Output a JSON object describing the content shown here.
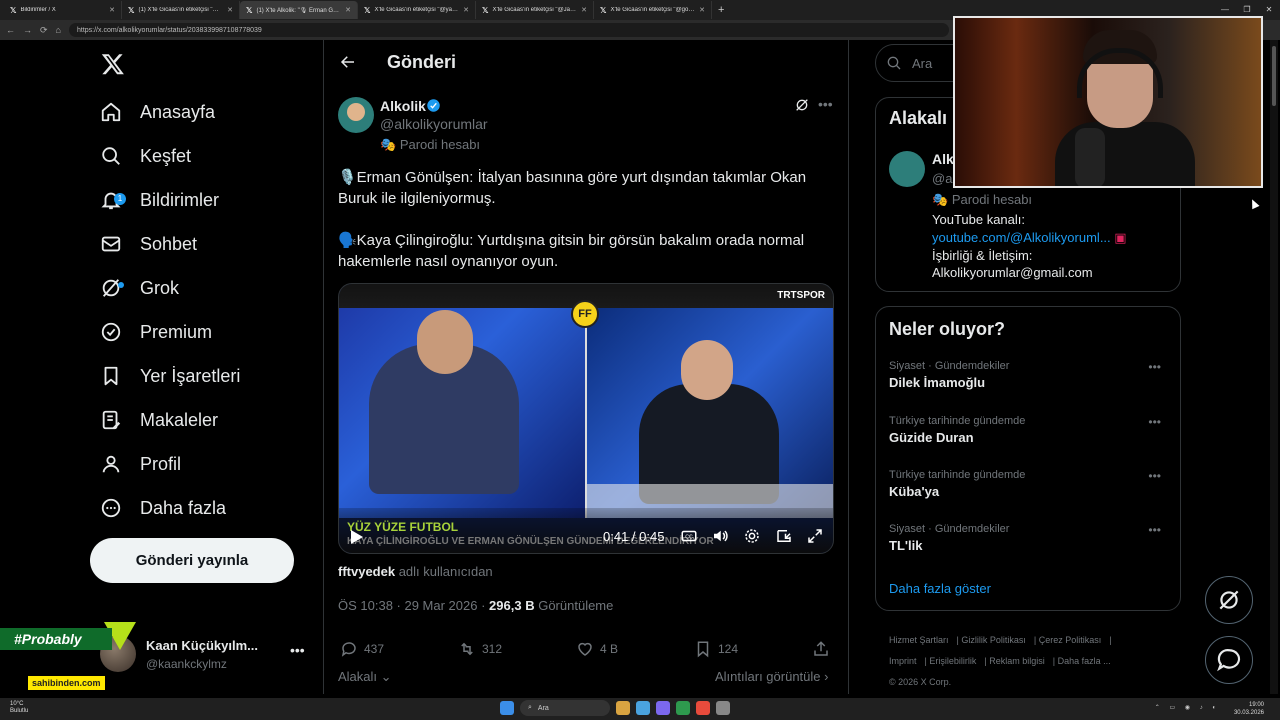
{
  "browser": {
    "tabs": [
      {
        "label": "Bildirimler / X"
      },
      {
        "label": "(1) X'te Gicaas'ın etiketçisi \"@mu"
      },
      {
        "label": "(1) X'te Alkolik: \"🎙 Erman Gönülş"
      },
      {
        "label": "X'te Gicaas'ın etiketçisi \"@yakob"
      },
      {
        "label": "X'te Gicaas'ın etiketçisi \"@Jalmir"
      },
      {
        "label": "X'te Gicaas'ın etiketçisi \"@govek"
      }
    ],
    "url": "https://x.com/alkolikyorumlar/status/2038339987108778039"
  },
  "sidebar": {
    "items": [
      {
        "label": "Anasayfa",
        "icon": "home-icon"
      },
      {
        "label": "Keşfet",
        "icon": "search-icon"
      },
      {
        "label": "Bildirimler",
        "icon": "bell-icon",
        "badge": "1"
      },
      {
        "label": "Sohbet",
        "icon": "mail-icon"
      },
      {
        "label": "Grok",
        "icon": "grok-icon"
      },
      {
        "label": "Premium",
        "icon": "verified-icon"
      },
      {
        "label": "Yer İşaretleri",
        "icon": "bookmark-icon"
      },
      {
        "label": "Makaleler",
        "icon": "article-icon"
      },
      {
        "label": "Profil",
        "icon": "profile-icon"
      },
      {
        "label": "Daha fazla",
        "icon": "more-circle-icon"
      }
    ],
    "post_button": "Gönderi yayınla",
    "account": {
      "name": "Kaan Küçükyılm...",
      "handle": "@kaankckylmz"
    }
  },
  "overlay": {
    "probably": "#Probably",
    "sahibinden": "sahibinden.com"
  },
  "main": {
    "title": "Gönderi",
    "tweet": {
      "author_name": "Alkolik",
      "author_handle": "@alkolikyorumlar",
      "parody_label": "Parodi hesabı",
      "text_1": "🎙️Erman Gönülşen: İtalyan basınına göre yurt dışından takımlar Okan Buruk ile ilgileniyormuş.",
      "text_2": "🗣️Kaya Çilingiroğlu: Yurtdışına gitsin bir görsün bakalım orada normal hakemlerle nasıl oynanıyor oyun.",
      "video": {
        "caption_1": "YÜZ YÜZE FUTBOL",
        "caption_2": "KAYA ÇİLİNGİROĞLU VE ERMAN GÖNÜLŞEN GÜNDEMİ DEĞERLENDİRİYOR",
        "time": "0:41 / 0:45",
        "channel": "TRTSPOR",
        "badge": "FF",
        "progress": 0.91
      },
      "tagged_by_user": "fftvyedek",
      "tagged_by_suffix": "adlı kullanıcıdan",
      "time": "ÖS 10:38 · 29 Mar 2026",
      "views_count": "296,3 B",
      "views_label": "Görüntüleme",
      "replies": "437",
      "reposts": "312",
      "likes": "4 B",
      "bookmarks": "124"
    },
    "related_label": "Alakalı",
    "quotes_label": "Alıntıları görüntüle"
  },
  "right": {
    "search_placeholder": "Ara",
    "related": {
      "title": "Alakalı",
      "name": "Alk",
      "handle": "@a",
      "parody": "Parodi hesabı",
      "bio_1": "YouTube kanalı:",
      "bio_link": "youtube.com/@Alkolikyoruml...",
      "bio_3": "İşbirliği & İletişim:",
      "bio_4": "Alkolikyorumlar@gmail.com"
    },
    "trends": {
      "title": "Neler oluyor?",
      "items": [
        {
          "category": "Siyaset · Gündemdekiler",
          "name": "Dilek İmamoğlu"
        },
        {
          "category": "Türkiye tarihinde gündemde",
          "name": "Güzide Duran"
        },
        {
          "category": "Türkiye tarihinde gündemde",
          "name": "Küba'ya"
        },
        {
          "category": "Siyaset · Gündemdekiler",
          "name": "TL'lik"
        }
      ],
      "show_more": "Daha fazla göster"
    },
    "footer": {
      "l1": "Hizmet Şartları",
      "l2": "Gizlilik Politikası",
      "l3": "Çerez Politikası",
      "l4": "Imprint",
      "l5": "Erişilebilirlik",
      "l6": "Reklam bilgisi",
      "l7": "Daha fazla ...",
      "copyright": "© 2026 X Corp."
    }
  },
  "taskbar": {
    "weather_temp": "10°C",
    "weather_desc": "Bulutlu",
    "search": "Ara",
    "time": "19:00",
    "date": "30.03.2026"
  },
  "colors": {
    "accent": "#1d9bf0",
    "background": "#000000",
    "border": "#2f3336",
    "muted": "#71767b"
  }
}
